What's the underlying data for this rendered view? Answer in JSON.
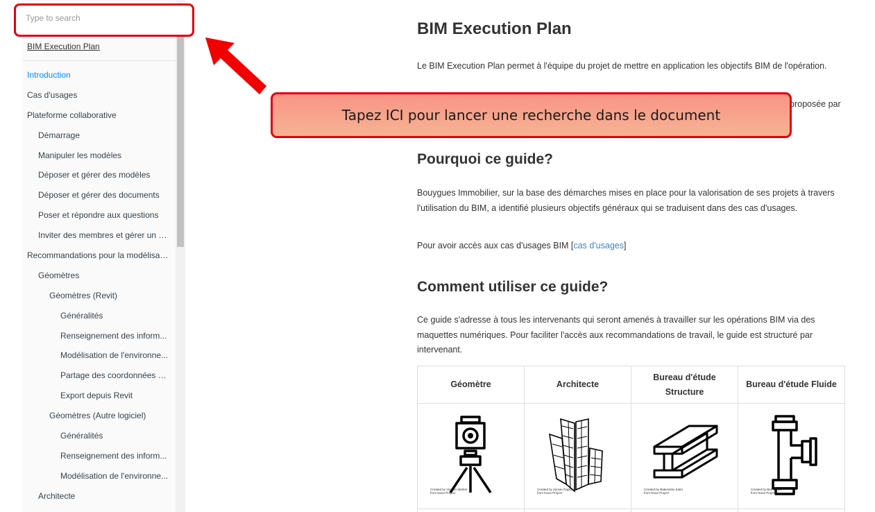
{
  "sidebar": {
    "search_placeholder": "Type to search",
    "book_title": "BIM Execution Plan",
    "items": [
      {
        "label": "Introduction",
        "level": 0,
        "active": true
      },
      {
        "label": "Cas d'usages",
        "level": 0
      },
      {
        "label": "Plateforme collaborative",
        "level": 0
      },
      {
        "label": "Démarrage",
        "level": 1
      },
      {
        "label": "Manipuler les modèles",
        "level": 1
      },
      {
        "label": "Déposer et gérer des modèles",
        "level": 1
      },
      {
        "label": "Déposer et gérer des documents",
        "level": 1
      },
      {
        "label": "Poser et répondre aux questions",
        "level": 1
      },
      {
        "label": "Inviter des membres et gérer un p...",
        "level": 1
      },
      {
        "label": "Recommandations pour la modélisati...",
        "level": 0
      },
      {
        "label": "Géomètres",
        "level": 1
      },
      {
        "label": "Géomètres (Revit)",
        "level": 2
      },
      {
        "label": "Généralités",
        "level": 3
      },
      {
        "label": "Renseignement des inform...",
        "level": 3
      },
      {
        "label": "Modélisation de l'environne...",
        "level": 3
      },
      {
        "label": "Partage des coordonnées p...",
        "level": 3
      },
      {
        "label": "Export depuis Revit",
        "level": 3
      },
      {
        "label": "Géomètres (Autre logiciel)",
        "level": 2
      },
      {
        "label": "Généralités",
        "level": 3
      },
      {
        "label": "Renseignement des inform...",
        "level": 3
      },
      {
        "label": "Modélisation de l'environne...",
        "level": 3
      },
      {
        "label": "Architecte",
        "level": 1
      }
    ]
  },
  "content": {
    "title": "BIM Execution Plan",
    "intro_p1": "Le BIM Execution Plan permet à l'équipe du projet de mettre en application les objectifs BIM de l'opération.",
    "intro_p2_fragment": "proposée par",
    "section_why": {
      "heading": "Pourquoi ce guide?",
      "p1": "Bouygues Immobilier, sur la base des démarches mises en place pour la valorisation de ses projets à travers l'utilisation du BIM, a identifié plusieurs objectifs généraux qui se traduisent dans des cas d'usages.",
      "p2_before": "Pour avoir accès aux cas d'usages BIM [",
      "p2_link": "cas d'usages",
      "p2_after": "]"
    },
    "section_how": {
      "heading": "Comment utiliser ce guide?",
      "p1": "Ce guide s'adresse à tous les intervenants qui seront amenés à travailler sur les opérations BIM via des maquettes numériques. Pour faciliter l'accès aux recommandations de travail, le guide est structuré par intervenant."
    },
    "table": {
      "headers": [
        "Géomètre",
        "Architecte",
        "Bureau d'étude Structure",
        "Bureau d'étude Fluide"
      ],
      "icons": [
        "surveyor-tripod-icon",
        "buildings-icon",
        "steel-beam-icon",
        "pipe-fitting-icon"
      ],
      "credits": [
        [
          "Created by Vectors Market",
          "from Noun Project"
        ],
        [
          "Created by Zyman Raphael",
          "from Noun Project"
        ],
        [
          "Created by Bakunetsu Kaito",
          "from Noun Project"
        ],
        [
          "Created by Ben Davis",
          "from Noun Project"
        ]
      ]
    }
  },
  "annotation": {
    "callout_text": "Tapez ICI pour lancer une recherche dans le document",
    "accent_color": "#e0000c"
  }
}
